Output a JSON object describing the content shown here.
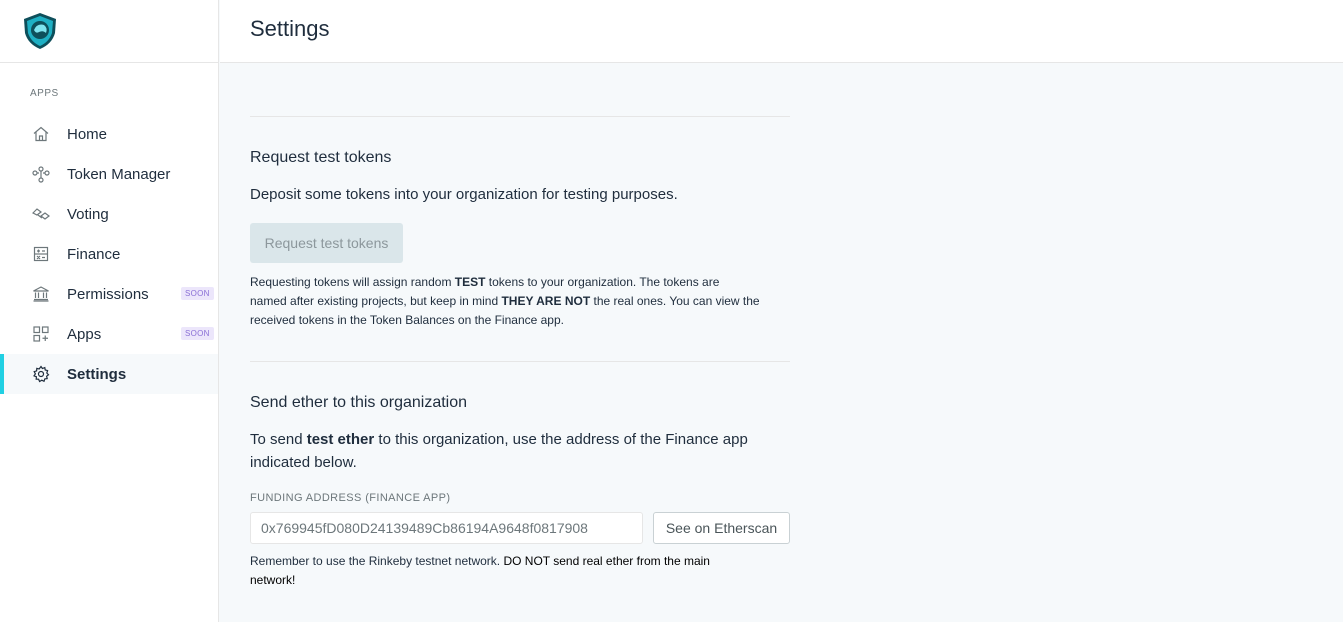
{
  "sidebar": {
    "apps_label": "APPS",
    "items": [
      {
        "label": "Home",
        "icon": "home-icon"
      },
      {
        "label": "Token Manager",
        "icon": "token-manager-icon"
      },
      {
        "label": "Voting",
        "icon": "voting-icon"
      },
      {
        "label": "Finance",
        "icon": "finance-icon"
      },
      {
        "label": "Permissions",
        "icon": "permissions-icon",
        "badge": "SOON"
      },
      {
        "label": "Apps",
        "icon": "apps-icon",
        "badge": "SOON"
      },
      {
        "label": "Settings",
        "icon": "settings-icon",
        "active": true
      }
    ]
  },
  "header": {
    "title": "Settings"
  },
  "request_tokens": {
    "title": "Request test tokens",
    "description": "Deposit some tokens into your organization for testing purposes.",
    "button_label": "Request test tokens",
    "note_line1_pre": "Requesting tokens will assign random ",
    "note_line1_bold": "TEST",
    "note_line1_post": " tokens to your organization. The tokens are",
    "note_line2_pre": "named after existing projects, but keep in mind ",
    "note_line2_bold": "THEY ARE NOT",
    "note_line2_post": " the real ones. You can view the",
    "note_line3": "received tokens in the Token Balances on the Finance app."
  },
  "send_ether": {
    "title": "Send ether to this organization",
    "desc_pre": "To send ",
    "desc_bold": "test ether",
    "desc_post": " to this organization, use the address of the Finance app",
    "desc_line2": "indicated below.",
    "field_label": "FUNDING ADDRESS (FINANCE APP)",
    "address": "0x769945fD080D24139489Cb86194A9648f0817908",
    "etherscan_label": "See on Etherscan",
    "warning_line1_pre": "Remember to use the Rinkeby testnet network. ",
    "warning_line1_bold": "DO NOT send real ether from the main",
    "warning_line2_bold": "network!"
  },
  "colors": {
    "accent": "#21d0e3",
    "soon_badge_text": "#8a6fd6",
    "soon_badge_bg": "#ece6fb",
    "request_button_bg": "#dae6ea",
    "content_bg": "#f6f9fb"
  }
}
